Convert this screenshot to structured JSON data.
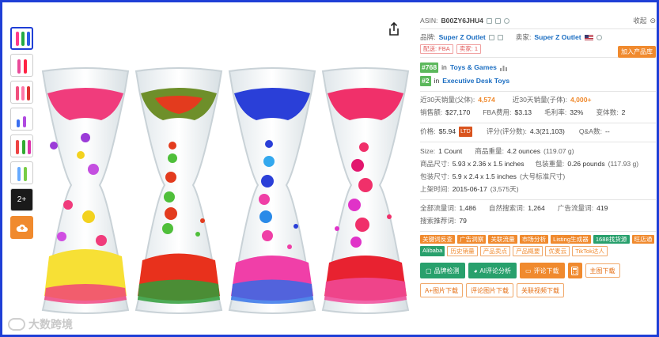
{
  "thumbnails": {
    "more_label": "2+"
  },
  "panel": {
    "asin_label": "ASIN:",
    "asin": "B00ZY6JHU4",
    "collapse_label": "收起",
    "brand_label": "品牌:",
    "brand": "Super Z Outlet",
    "seller_label": "卖家:",
    "seller": "Super Z Outlet",
    "delivery_tag": "配送: FBA",
    "seller_count_tag": "卖家: 1",
    "add_product_label": "加入产品库",
    "rank1_num": "#768",
    "rank_in": "in",
    "rank1_cat": "Toys & Games",
    "rank2_num": "#2",
    "rank2_cat": "Executive Desk Toys",
    "sales30_parent_label": "近30天销量(父体):",
    "sales30_parent": "4,574",
    "sales30_child_label": "近30天销量(子体):",
    "sales30_child": "4,000+",
    "revenue_label": "销售额:",
    "revenue": "$27,170",
    "fba_label": "FBA费用:",
    "fba": "$3.13",
    "margin_label": "毛利率:",
    "margin": "32%",
    "variants_label": "变体数:",
    "variants": "2",
    "price_label": "价格:",
    "price": "$5.94",
    "ltd_label": "LTD",
    "rating_label": "评分(评分数):",
    "rating": "4.3(21,103)",
    "qa_label": "Q&A数:",
    "qa": "--",
    "size_label": "Size:",
    "size": "1 Count",
    "weight_label": "商品重量:",
    "weight": "4.2 ounces",
    "weight_g": "(119.07 g)",
    "dims_label": "商品尺寸:",
    "dims": "5.93 x 2.36 x 1.5 inches",
    "pkg_weight_label": "包装重量:",
    "pkg_weight": "0.26 pounds",
    "pkg_weight_g": "(117.93 g)",
    "pkg_dims_label": "包装尺寸:",
    "pkg_dims": "5.9 x 2.4 x 1.5 inches",
    "pkg_std": "(大号标准尺寸)",
    "launch_label": "上架时间:",
    "launch": "2015-06-17",
    "launch_days": "(3,575天)",
    "traffic_label": "全部流量词:",
    "traffic": "1,486",
    "organic_label": "自然搜索词:",
    "organic": "1,264",
    "ad_label": "广告流量词:",
    "ad": "419",
    "rec_label": "搜索推荐词:",
    "rec": "79",
    "tags": [
      {
        "label": "关键词反查",
        "style": "o"
      },
      {
        "label": "广告洞察",
        "style": "o"
      },
      {
        "label": "关联流量",
        "style": "o"
      },
      {
        "label": "市场分析",
        "style": "o"
      },
      {
        "label": "Listing生成器",
        "style": "o"
      },
      {
        "label": "1688找货源",
        "style": "g"
      },
      {
        "label": "旺店通",
        "style": "o"
      },
      {
        "label": "Alibaba",
        "style": "g"
      },
      {
        "label": "历史销量",
        "style": "b"
      },
      {
        "label": "产品卖点",
        "style": "b"
      },
      {
        "label": "产品概要",
        "style": "b"
      },
      {
        "label": "优麦云",
        "style": "b"
      },
      {
        "label": "TikTok达人",
        "style": "b"
      }
    ],
    "btn_brand_check": "品牌检测",
    "btn_ai_review": "AI评论分析",
    "btn_review_download": "评论下载",
    "btn_main_image": "主图下载",
    "btn_aplus": "A+图片下载",
    "btn_review_images": "评论图片下载",
    "btn_related_video": "关联视频下载"
  },
  "watermark": {
    "text": "大数跨境"
  },
  "colors": {
    "accent_orange": "#f08a2e",
    "accent_green": "#28a06c",
    "frame_blue": "#1f3fd6"
  }
}
